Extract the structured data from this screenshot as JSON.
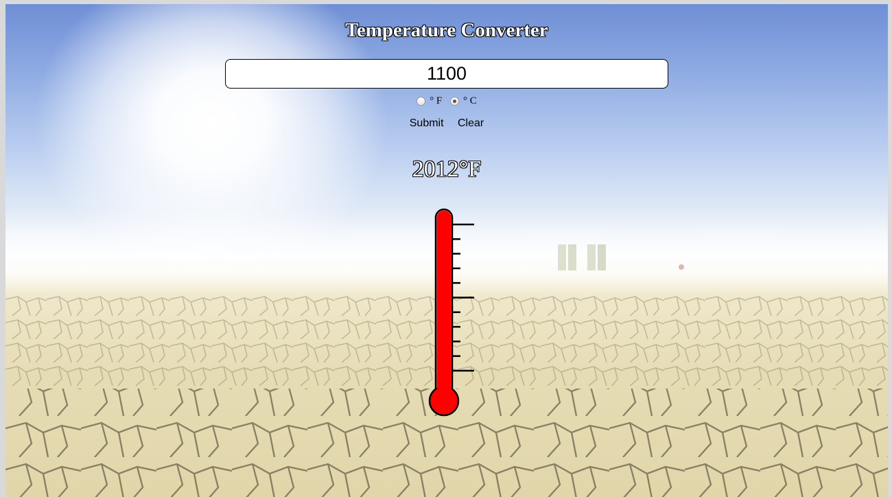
{
  "app": {
    "title": "Temperature Converter"
  },
  "input": {
    "value": "1100"
  },
  "units": [
    {
      "label": "° F",
      "checked": false
    },
    {
      "label": "° C",
      "checked": true
    }
  ],
  "buttons": {
    "submit_label": "Submit",
    "clear_label": "Clear"
  },
  "result": {
    "text": "2012°F"
  },
  "thermometer": {
    "fill_fraction": 1.0,
    "color": "#ff0000"
  }
}
